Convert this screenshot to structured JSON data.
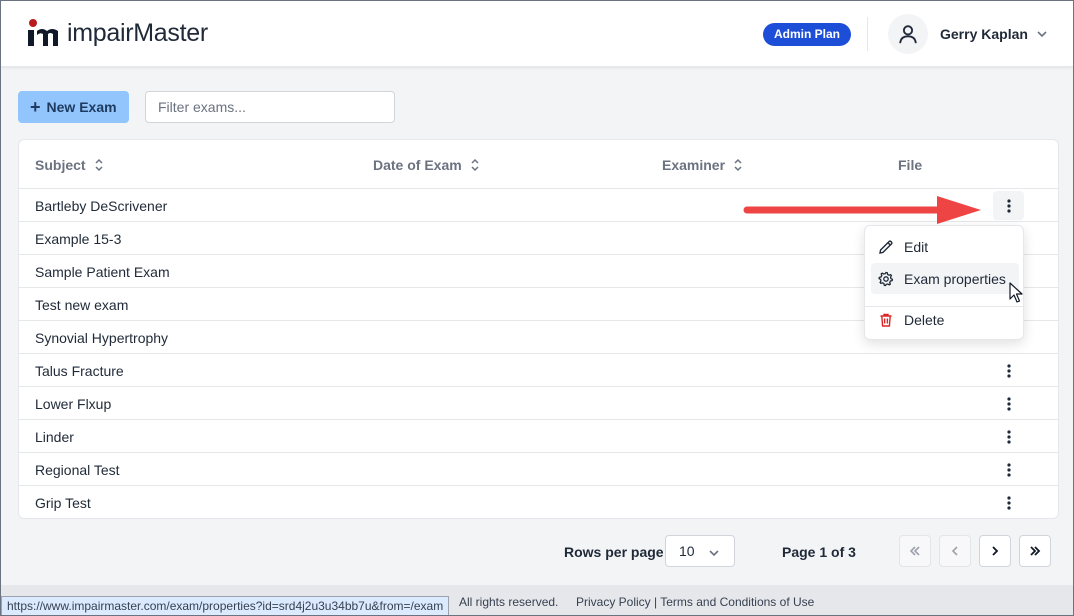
{
  "brand": {
    "name": "impairMaster",
    "accent": "#b91c1c"
  },
  "header": {
    "plan_badge": "Admin Plan",
    "user_name": "Gerry Kaplan"
  },
  "toolbar": {
    "new_exam_label": "New Exam",
    "filter_placeholder": "Filter exams..."
  },
  "table": {
    "columns": [
      "Subject",
      "Date of Exam",
      "Examiner",
      "File"
    ],
    "rows": [
      "Bartleby DeScrivener",
      "Example 15-3",
      "Sample Patient Exam",
      "Test new exam",
      "Synovial Hypertrophy",
      "Talus Fracture",
      "Lower Flxup",
      "Linder",
      "Regional Test",
      "Grip Test"
    ]
  },
  "row_menu": {
    "edit": "Edit",
    "properties": "Exam properties",
    "delete": "Delete",
    "delete_color": "#dc2626"
  },
  "pagination": {
    "rows_per_page_label": "Rows per page",
    "rows_per_page": "10",
    "page_label": "Page 1 of 3"
  },
  "footer": {
    "status_url": "https://www.impairmaster.com/exam/properties?id=srd4j2u3u34bb7u&from=/exam",
    "rights": "All rights reserved.",
    "links": "Privacy Policy | Terms and Conditions of Use"
  },
  "annotation": {
    "arrow_color": "#ef4444"
  }
}
